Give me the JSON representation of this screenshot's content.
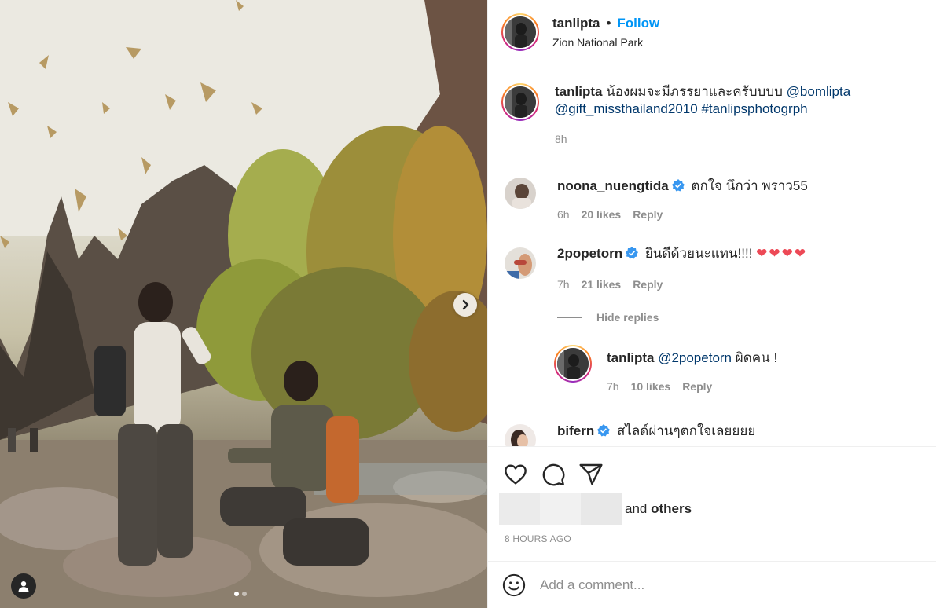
{
  "post": {
    "username": "tanlipta",
    "follow_label": "Follow",
    "separator": "•",
    "location": "Zion National Park"
  },
  "caption": {
    "username": "tanlipta",
    "text": "น้องผมจะมีภรรยาและครับบบบ",
    "mention1": "@bomlipta",
    "mention2": "@gift_missthailand2010",
    "hashtag": "#tanlipsphotogrph",
    "time": "8h"
  },
  "comments": [
    {
      "username": "noona_nuengtida",
      "text": "ตกใจ นึกว่า พราว55",
      "time": "6h",
      "likes": "20 likes",
      "reply": "Reply"
    },
    {
      "username": "2popetorn",
      "text": "ยินดีด้วยนะแทน!!!! ",
      "emoji": "❤❤❤❤",
      "time": "7h",
      "likes": "21 likes",
      "reply": "Reply"
    }
  ],
  "hide_replies": "Hide replies",
  "reply": {
    "username": "tanlipta",
    "mention": "@2popetorn",
    "text": " ผิดคน !",
    "time": "7h",
    "likes": "10 likes",
    "reply": "Reply"
  },
  "partial_comment": {
    "username": "bifern",
    "text": "สไลด์ผ่านๆตกใจเลยยยย"
  },
  "likes_line": {
    "and": "and",
    "others": "others"
  },
  "timestamp": "8 HOURS AGO",
  "add_comment": {
    "placeholder": "Add a comment..."
  },
  "colors": {
    "accent": "#0095f6",
    "link": "#00376b",
    "verified": "#3897f0",
    "heart": "#ed4956"
  },
  "icons": [
    "heart-icon",
    "comment-icon",
    "share-icon",
    "chevron-right-icon",
    "user-tag-icon",
    "emoji-icon",
    "verified-badge-icon"
  ]
}
